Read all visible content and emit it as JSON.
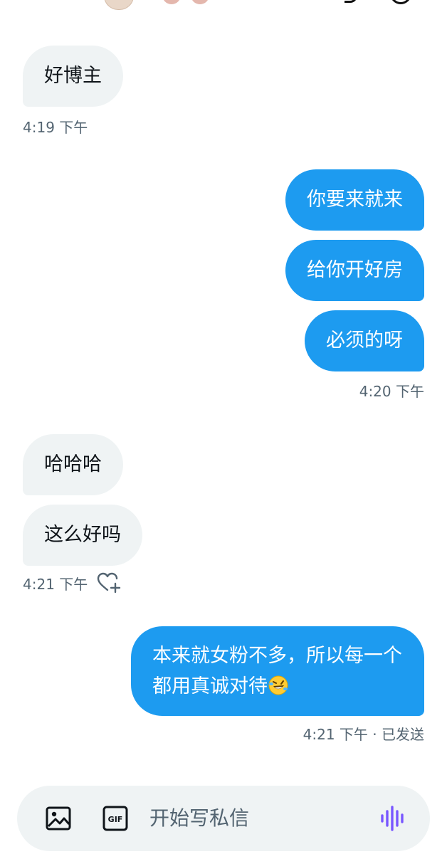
{
  "messages": [
    {
      "side": "in",
      "text": "好博主"
    },
    {
      "side": "out",
      "text": "你要来就来"
    },
    {
      "side": "out",
      "text": "给你开好房"
    },
    {
      "side": "out",
      "text": "必须的呀"
    },
    {
      "side": "in",
      "text": "哈哈哈"
    },
    {
      "side": "in",
      "text": "这么好吗"
    },
    {
      "side": "out",
      "text": "本来就女粉不多，所以每一个都用真诚对待"
    }
  ],
  "timestamps": {
    "t1": "4:19 下午",
    "t2": "4:20 下午",
    "t3": "4:21 下午",
    "t4": "4:21 下午 · 已发送"
  },
  "emoji": "rolling-on-floor-laughing",
  "composer": {
    "placeholder": "开始写私信",
    "gif_label": "GIF"
  },
  "colors": {
    "outgoing_bubble": "#1d9bf0",
    "incoming_bubble": "#eff3f4",
    "timestamp_text": "#536471",
    "voice_icon": "#7856ff"
  }
}
